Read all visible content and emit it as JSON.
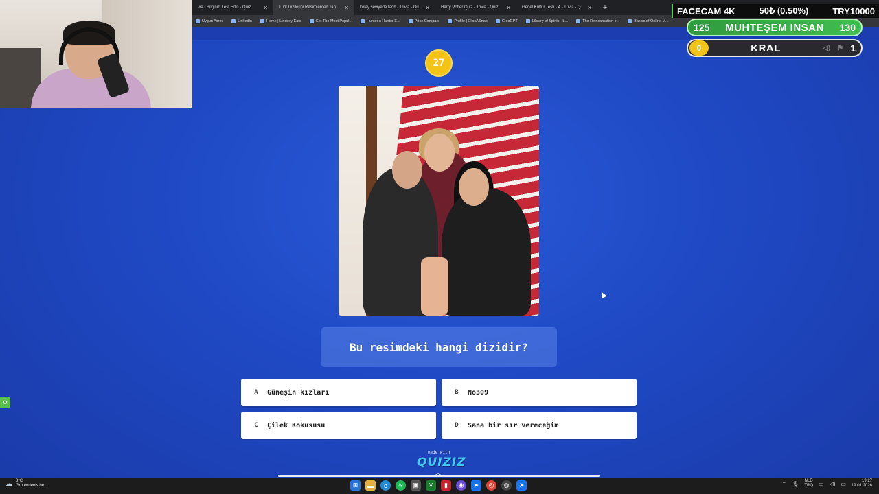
{
  "browser": {
    "tabs": [
      {
        "label": "via - Bilginizi Test Edin - Quiz",
        "active": false
      },
      {
        "label": "Türk Dizilerini Resimlerden Tah",
        "active": true
      },
      {
        "label": "kolay seviyede tarih - Trivia - Qu",
        "active": false
      },
      {
        "label": "Harry Potter Quiz - Trivia - Quiz",
        "active": false
      },
      {
        "label": "Genel Kültür Testi - 4 - Trivia - Q",
        "active": false
      }
    ],
    "new_tab": "+",
    "bookmarks": [
      "Uygun Acres",
      "LinkedIn",
      "Home | Lindsey Eats",
      "Get The Most Popul...",
      "Hunter x Hunter E...",
      "Price Compare",
      "Profile | ClickASnap",
      "GiooGPT",
      "Library of Spirits - L...",
      "The Reincarnation o...",
      "Basics of Online M..."
    ]
  },
  "stream_overlay": {
    "facecam_label": "FACECAM 4K",
    "goal_progress": "50₺ (0.50%)",
    "goal_target": "TRY10000",
    "rank_pill": {
      "left": "125",
      "title": "MUHTEŞEM INSAN",
      "right": "130"
    },
    "level_pill": {
      "left": "0",
      "title": "KRAL",
      "right": "1"
    }
  },
  "quiz": {
    "timer": "27",
    "question": "Bu resimdeki hangi dizidir?",
    "answers": [
      {
        "letter": "A",
        "text": "Güneşin kızları"
      },
      {
        "letter": "B",
        "text": "No309"
      },
      {
        "letter": "C",
        "text": "Çilek Kokususu"
      },
      {
        "letter": "D",
        "text": "Sana bir sır vereceğim"
      }
    ],
    "made_with": "made with",
    "brand": "QUIZIZ"
  },
  "taskbar": {
    "weather_temp": "3°C",
    "weather_desc": "Grotendeels be...",
    "lang_top": "NLD",
    "lang_bottom": "TRQ",
    "time": "19:27",
    "date": "19.01.2026"
  },
  "colors": {
    "background": "#1f49c4",
    "timer": "#f3c316",
    "rank_green": "#3fbf4f",
    "answer_bg": "#ffffff"
  }
}
